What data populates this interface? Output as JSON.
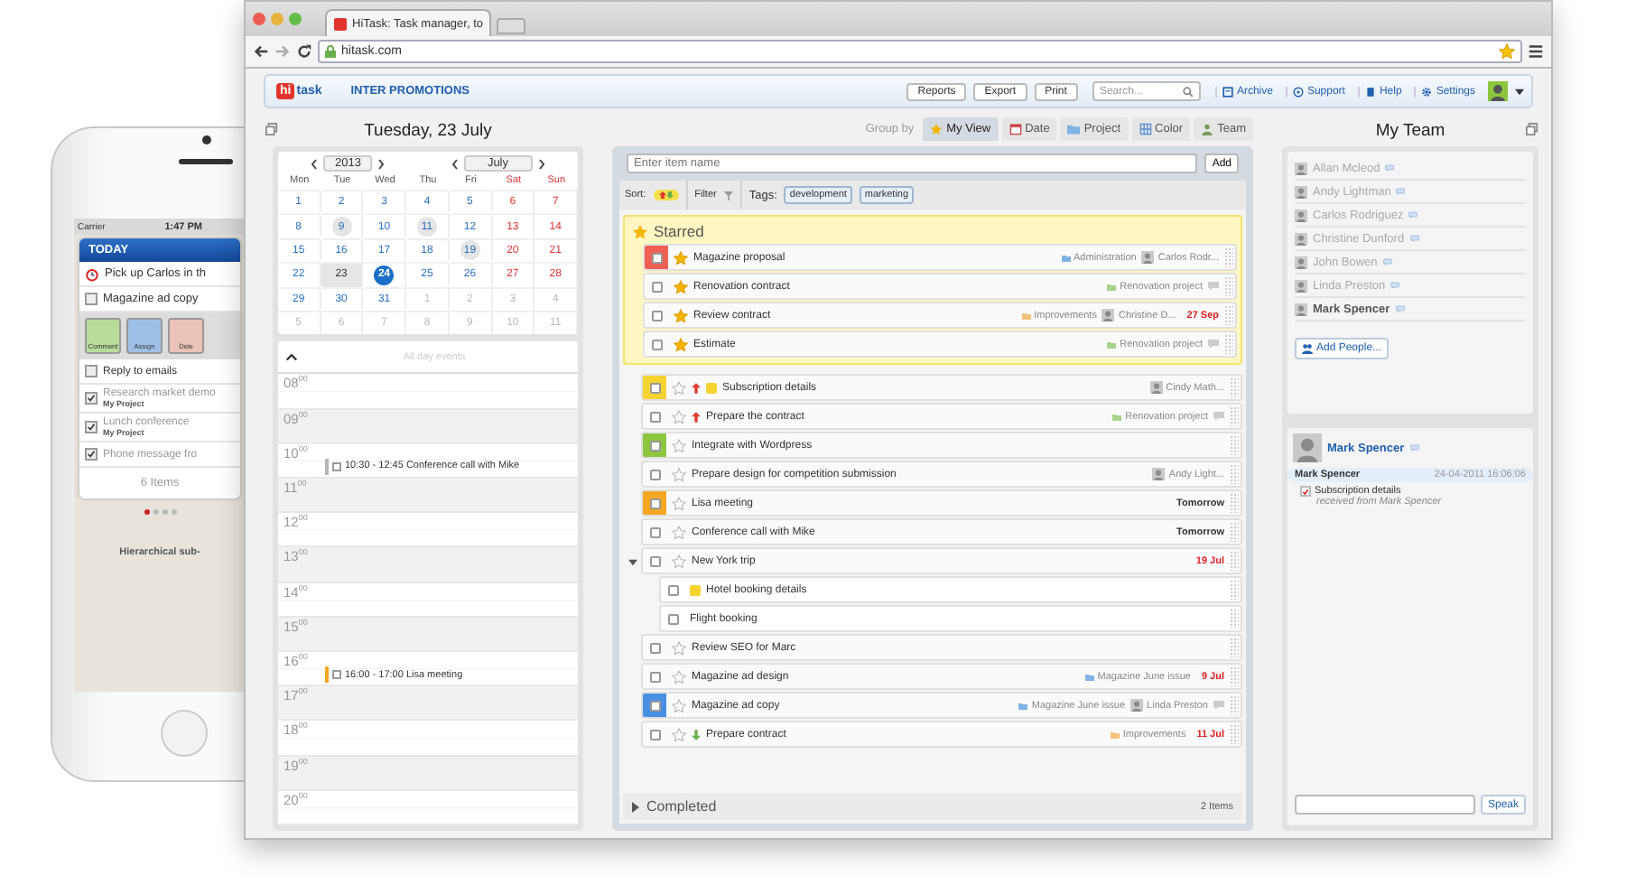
{
  "phone": {
    "carrier": "Carrier",
    "time": "1:47 PM",
    "header": "TODAY",
    "reminder": "Pick up Carlos in th",
    "swiped_task": {
      "title": "Magazine ad copy",
      "checked": false
    },
    "actions": [
      "Comment",
      "Assign",
      "Dele"
    ],
    "tasks": [
      {
        "title": "Reply to emails",
        "checked": false
      },
      {
        "title": "Research market demo",
        "project": "My Project",
        "checked": true
      },
      {
        "title": "Lunch conference",
        "project": "My Project",
        "checked": true
      },
      {
        "title": "Phone message fro",
        "checked": true
      }
    ],
    "count": "6 Items",
    "pages": [
      {
        "selected": true
      },
      {
        "selected": false
      },
      {
        "selected": false
      },
      {
        "selected": false
      }
    ],
    "caption": "Hierarchical sub-"
  },
  "browser": {
    "tab_title": "HiTask: Task manager, to",
    "url": "hitask.com"
  },
  "app_header": {
    "logo_mark": "hi",
    "logo_word": "task",
    "workspace": "INTER PROMOTIONS",
    "buttons": [
      "Reports",
      "Export",
      "Print"
    ],
    "search_placeholder": "Search...",
    "links": [
      "Archive",
      "Support",
      "Help",
      "Settings"
    ]
  },
  "calendar": {
    "title": "Tuesday, 23 July",
    "year": "2013",
    "month": "July",
    "weekdays": [
      {
        "label": "Mon",
        "weekend": false
      },
      {
        "label": "Tue",
        "weekend": false
      },
      {
        "label": "Wed",
        "weekend": false
      },
      {
        "label": "Thu",
        "weekend": false
      },
      {
        "label": "Fri",
        "weekend": false
      },
      {
        "label": "Sat",
        "weekend": true
      },
      {
        "label": "Sun",
        "weekend": true
      }
    ],
    "weeks": [
      [
        {
          "label": "1",
          "kind": "day"
        },
        {
          "label": "2",
          "kind": "day"
        },
        {
          "label": "3",
          "kind": "day"
        },
        {
          "label": "4",
          "kind": "day"
        },
        {
          "label": "5",
          "kind": "day"
        },
        {
          "label": "6",
          "kind": "weekend"
        },
        {
          "label": "7",
          "kind": "weekend"
        }
      ],
      [
        {
          "label": "8",
          "kind": "day"
        },
        {
          "label": "9",
          "kind": "marked"
        },
        {
          "label": "10",
          "kind": "day"
        },
        {
          "label": "11",
          "kind": "marked"
        },
        {
          "label": "12",
          "kind": "day"
        },
        {
          "label": "13",
          "kind": "weekend"
        },
        {
          "label": "14",
          "kind": "weekend"
        }
      ],
      [
        {
          "label": "15",
          "kind": "day"
        },
        {
          "label": "16",
          "kind": "day"
        },
        {
          "label": "17",
          "kind": "day"
        },
        {
          "label": "18",
          "kind": "day"
        },
        {
          "label": "19",
          "kind": "marked"
        },
        {
          "label": "20",
          "kind": "weekend"
        },
        {
          "label": "21",
          "kind": "weekend"
        }
      ],
      [
        {
          "label": "22",
          "kind": "day"
        },
        {
          "label": "23",
          "kind": "selected"
        },
        {
          "label": "24",
          "kind": "today"
        },
        {
          "label": "25",
          "kind": "day"
        },
        {
          "label": "26",
          "kind": "day"
        },
        {
          "label": "27",
          "kind": "weekend"
        },
        {
          "label": "28",
          "kind": "weekend"
        }
      ],
      [
        {
          "label": "29",
          "kind": "day"
        },
        {
          "label": "30",
          "kind": "day"
        },
        {
          "label": "31",
          "kind": "day"
        },
        {
          "label": "1",
          "kind": "outside"
        },
        {
          "label": "2",
          "kind": "outside"
        },
        {
          "label": "3",
          "kind": "outside"
        },
        {
          "label": "4",
          "kind": "outside"
        }
      ],
      [
        {
          "label": "5",
          "kind": "outside"
        },
        {
          "label": "6",
          "kind": "outside"
        },
        {
          "label": "7",
          "kind": "outside"
        },
        {
          "label": "8",
          "kind": "outside"
        },
        {
          "label": "9",
          "kind": "outside"
        },
        {
          "label": "10",
          "kind": "outside"
        },
        {
          "label": "11",
          "kind": "outside"
        }
      ]
    ]
  },
  "day_view": {
    "all_day_label": "All day events",
    "hours": [
      {
        "label": "08$^{00}$"
      },
      {
        "label": "09$^{00}$"
      },
      {
        "label": "10$^{00}$",
        "events": [
          {
            "text": "10:30 - 12:45 Conference call with Mike",
            "color": "#b5b5b5",
            "checked": false
          }
        ]
      },
      {
        "label": "11$^{00}$"
      },
      {
        "label": "12$^{00}$"
      },
      {
        "label": "13$^{00}$"
      },
      {
        "label": "14$^{00}$"
      },
      {
        "label": "15$^{00}$"
      },
      {
        "label": "16$^{00}$",
        "events": [
          {
            "text": "16:00 - 17:00 Lisa meeting",
            "color": "#f5a623",
            "checked": false
          }
        ]
      },
      {
        "label": "17$^{00}$"
      },
      {
        "label": "18$^{00}$"
      },
      {
        "label": "19$^{00}$"
      },
      {
        "label": "20$^{00}$"
      }
    ]
  },
  "group_by": {
    "label": "Group by",
    "tabs": [
      {
        "label": "My View",
        "selected": true
      },
      {
        "label": "Date",
        "selected": false
      },
      {
        "label": "Project",
        "selected": false
      },
      {
        "label": "Color",
        "selected": false
      },
      {
        "label": "Team",
        "selected": false
      }
    ]
  },
  "tasks_panel": {
    "new_item_placeholder": "Enter item name",
    "add_button": "Add",
    "sort_label": "Sort:",
    "filter_label": "Filter",
    "tags_label": "Tags:",
    "tags": [
      "development",
      "marketing"
    ],
    "starred": {
      "title": "Starred",
      "items": [
        {
          "title": "Magazine proposal",
          "color": "#ef5f55",
          "checked": false,
          "starred": true,
          "high_priority": false,
          "low_priority": false,
          "note": false,
          "comments": false,
          "project": {
            "name": "Administration",
            "color": "#7fb3e3"
          },
          "assignee": "Carlos Rodr..."
        },
        {
          "title": "Renovation contract",
          "checked": false,
          "starred": true,
          "high_priority": false,
          "low_priority": false,
          "note": false,
          "comments": true,
          "project": {
            "name": "Renovation project",
            "color": "#a5d48a"
          }
        },
        {
          "title": "Review contract",
          "checked": false,
          "starred": true,
          "high_priority": false,
          "low_priority": false,
          "note": false,
          "comments": false,
          "project": {
            "name": "Improvements",
            "color": "#f2c27c"
          },
          "assignee": "Christine D...",
          "due": {
            "text": "27 Sep",
            "overdue": true
          }
        },
        {
          "title": "Estimate",
          "checked": false,
          "starred": true,
          "high_priority": false,
          "low_priority": false,
          "note": false,
          "comments": true,
          "project": {
            "name": "Renovation project",
            "color": "#a5d48a"
          }
        }
      ]
    },
    "items": [
      {
        "title": "Subscription details",
        "color": "#f5d432",
        "checked": false,
        "starred": false,
        "high_priority": true,
        "low_priority": false,
        "note": true,
        "comments": false,
        "assignee": "Cindy Math..."
      },
      {
        "title": "Prepare the contract",
        "checked": false,
        "starred": false,
        "high_priority": true,
        "low_priority": false,
        "note": false,
        "comments": true,
        "project": {
          "name": "Renovation project",
          "color": "#a5d48a"
        }
      },
      {
        "title": "Integrate with Wordpress",
        "color": "#8cc63f",
        "checked": false,
        "starred": false,
        "high_priority": false,
        "low_priority": false,
        "note": false,
        "comments": false
      },
      {
        "title": "Prepare design for competition submission",
        "checked": false,
        "starred": false,
        "high_priority": false,
        "low_priority": false,
        "note": false,
        "comments": false,
        "assignee": "Andy Light..."
      },
      {
        "title": "Lisa meeting",
        "color": "#f5a623",
        "checked": false,
        "starred": false,
        "high_priority": false,
        "low_priority": false,
        "note": false,
        "comments": false,
        "due": {
          "text": "Tomorrow",
          "overdue": false
        }
      },
      {
        "title": "Conference call with Mike",
        "checked": false,
        "starred": false,
        "high_priority": false,
        "low_priority": false,
        "note": false,
        "comments": false,
        "due": {
          "text": "Tomorrow",
          "overdue": false
        }
      },
      {
        "title": "New York trip",
        "checked": false,
        "starred": false,
        "high_priority": false,
        "low_priority": false,
        "note": false,
        "comments": false,
        "due": {
          "text": "19 Jul",
          "overdue": true
        },
        "expanded": true,
        "children": [
          {
            "title": "Hotel booking details",
            "checked": false,
            "note": true
          },
          {
            "title": "Flight booking",
            "checked": false,
            "note": false
          }
        ]
      },
      {
        "title": "Review SEO for Marc",
        "checked": false,
        "starred": false,
        "high_priority": false,
        "low_priority": false,
        "note": false,
        "comments": false
      },
      {
        "title": "Magazine ad design",
        "checked": false,
        "starred": false,
        "high_priority": false,
        "low_priority": false,
        "note": false,
        "comments": false,
        "project": {
          "name": "Magazine June issue",
          "color": "#7fb3e3"
        },
        "due": {
          "text": "9 Jul",
          "overdue": true
        }
      },
      {
        "title": "Magazine ad copy",
        "color": "#4a90e2",
        "checked": false,
        "starred": false,
        "high_priority": false,
        "low_priority": false,
        "note": false,
        "comments": true,
        "project": {
          "name": "Magazine June issue",
          "color": "#7fb3e3"
        },
        "assignee": "Linda Preston"
      },
      {
        "title": "Prepare contract",
        "checked": false,
        "starred": false,
        "high_priority": false,
        "low_priority": true,
        "note": false,
        "comments": false,
        "project": {
          "name": "Improvements",
          "color": "#f2c27c"
        },
        "due": {
          "text": "11 Jul",
          "overdue": true
        }
      }
    ],
    "completed": {
      "title": "Completed",
      "count": "2 Items",
      "expanded": false
    }
  },
  "team": {
    "title": "My Team",
    "members": [
      {
        "name": "Allan Mcleod",
        "selected": false
      },
      {
        "name": "Andy Lightman",
        "selected": false
      },
      {
        "name": "Carlos Rodriguez",
        "selected": false
      },
      {
        "name": "Christine Dunford",
        "selected": false
      },
      {
        "name": "John Bowen",
        "selected": false
      },
      {
        "name": "Linda Preston",
        "selected": false
      },
      {
        "name": "Mark Spencer",
        "selected": true
      }
    ],
    "add_people": "Add People...",
    "chat": {
      "contact": "Mark Spencer",
      "messages": [
        {
          "sender": "Mark Spencer",
          "time": "24-04-2011 16:06:06",
          "task": "Subscription details",
          "checked": true,
          "note": "received from Mark Spencer"
        }
      ],
      "send_button": "Speak"
    }
  }
}
